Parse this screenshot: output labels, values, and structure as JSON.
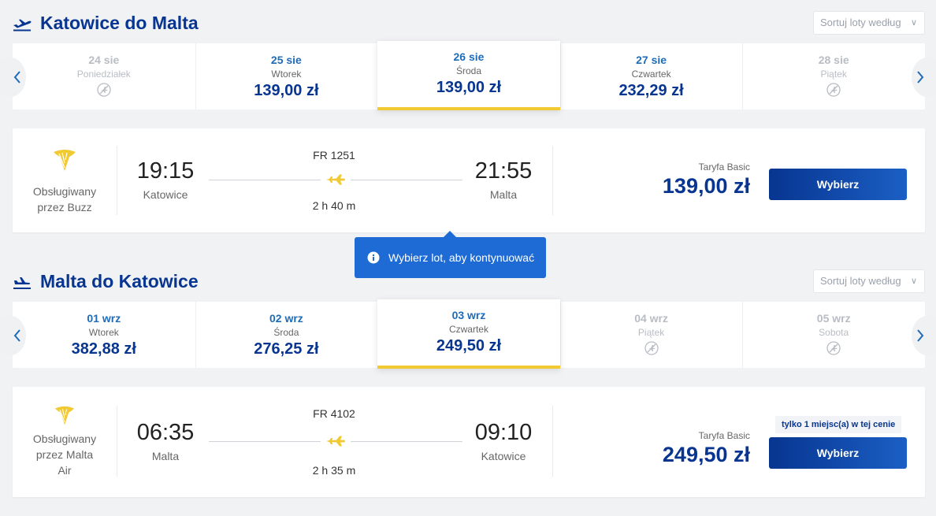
{
  "outbound": {
    "title": "Katowice do Malta",
    "sort_label": "Sortuj loty według",
    "dates": [
      {
        "date": "24 sie",
        "weekday": "Poniedziałek",
        "price": "",
        "available": false,
        "selected": false
      },
      {
        "date": "25 sie",
        "weekday": "Wtorek",
        "price": "139,00 zł",
        "available": true,
        "selected": false
      },
      {
        "date": "26 sie",
        "weekday": "Środa",
        "price": "139,00 zł",
        "available": true,
        "selected": true
      },
      {
        "date": "27 sie",
        "weekday": "Czwartek",
        "price": "232,29 zł",
        "available": true,
        "selected": false
      },
      {
        "date": "28 sie",
        "weekday": "Piątek",
        "price": "",
        "available": false,
        "selected": false
      }
    ],
    "flight": {
      "operator_lines": [
        "Obsługiwany",
        "przez Buzz"
      ],
      "flight_number": "FR 1251",
      "depart_time": "19:15",
      "depart_city": "Katowice",
      "arrive_time": "21:55",
      "arrive_city": "Malta",
      "duration": "2 h 40 m",
      "fare_label": "Taryfa Basic",
      "price": "139,00 zł",
      "button": "Wybierz"
    }
  },
  "tooltip": {
    "text": "Wybierz lot, aby kontynuować"
  },
  "inbound": {
    "title": "Malta do Katowice",
    "sort_label": "Sortuj loty według",
    "dates": [
      {
        "date": "01 wrz",
        "weekday": "Wtorek",
        "price": "382,88 zł",
        "available": true,
        "selected": false
      },
      {
        "date": "02 wrz",
        "weekday": "Środa",
        "price": "276,25 zł",
        "available": true,
        "selected": false
      },
      {
        "date": "03 wrz",
        "weekday": "Czwartek",
        "price": "249,50 zł",
        "available": true,
        "selected": true
      },
      {
        "date": "04 wrz",
        "weekday": "Piątek",
        "price": "",
        "available": false,
        "selected": false
      },
      {
        "date": "05 wrz",
        "weekday": "Sobota",
        "price": "",
        "available": false,
        "selected": false
      }
    ],
    "flight": {
      "operator_lines": [
        "Obsługiwany",
        "przez Malta",
        "Air"
      ],
      "flight_number": "FR 4102",
      "depart_time": "06:35",
      "depart_city": "Malta",
      "arrive_time": "09:10",
      "arrive_city": "Katowice",
      "duration": "2 h 35 m",
      "seats_badge": "tylko 1 miejsc(a) w tej cenie",
      "fare_label": "Taryfa Basic",
      "price": "249,50 zł",
      "button": "Wybierz"
    }
  },
  "colors": {
    "brand": "#073590",
    "accent_yellow": "#f1c933",
    "link_blue": "#1e6bb8",
    "tooltip": "#1e6bd6"
  },
  "icons": [
    "plane-takeoff-icon",
    "plane-landing-icon",
    "chevron-left-icon",
    "chevron-right-icon",
    "no-flight-icon",
    "harp-logo-icon",
    "plane-icon",
    "info-icon",
    "chevron-down-icon"
  ]
}
